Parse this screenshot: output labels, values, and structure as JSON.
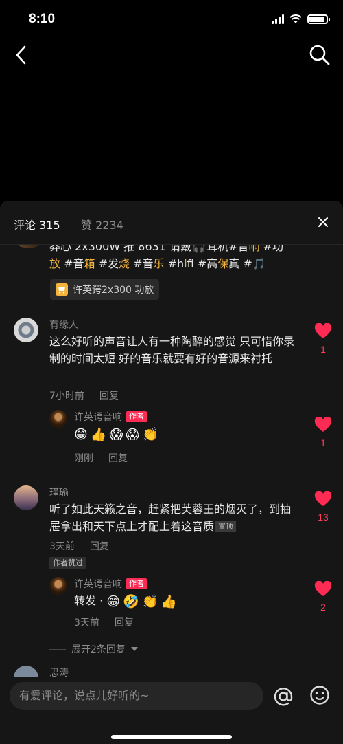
{
  "status_bar": {
    "time": "8:10",
    "battery_level": 0.9
  },
  "nav": {
    "back_icon": "chevron-left-icon",
    "search_icon": "search-icon"
  },
  "sheet": {
    "tab_comments": "评论 315",
    "tab_likes": "赞 2234",
    "close_icon": "close-icon"
  },
  "post": {
    "line1_pre": "莽心 2x300W 推 8631 请戴",
    "line1_mid": "耳机#音",
    "line1_hl": "响",
    "line1_post": " #功",
    "line2": [
      {
        "t": "放",
        "hl": true
      },
      {
        "t": " #音",
        "hl": false
      },
      {
        "t": "箱",
        "hl": true
      },
      {
        "t": " #发",
        "hl": false
      },
      {
        "t": "烧",
        "hl": true
      },
      {
        "t": " #音",
        "hl": false
      },
      {
        "t": "乐",
        "hl": true
      },
      {
        "t": " #h",
        "hl": false
      },
      {
        "t": "i",
        "hl": true
      },
      {
        "t": "fi #高",
        "hl": false
      },
      {
        "t": "保",
        "hl": true
      },
      {
        "t": "真",
        "hl": false
      },
      {
        "t": " #",
        "hl": false
      }
    ],
    "product_tag": "许英谔2x300 功放"
  },
  "comments": [
    {
      "username": "有缘人",
      "text": "这么好听的声音让人有一种陶醉的感觉 只可惜你录制的时间太短 好的音乐就要有好的音源来衬托",
      "time": "7小时前",
      "reply_label": "回复",
      "likes": "1"
    },
    {
      "username": "许英谔音响",
      "badge": "作者",
      "emojis": [
        "😁",
        "👍",
        "😱",
        "😱",
        "👏"
      ],
      "time": "刚刚",
      "reply_label": "回复",
      "likes": "1"
    },
    {
      "username": "瑾瑜",
      "text": "听了如此天籁之音，赶紧把芙蓉王的烟灭了，到抽屉拿出和天下点上才配上着这音质",
      "pin_badge": "置顶",
      "time": "3天前",
      "reply_label": "回复",
      "author_liked": "作者赞过",
      "likes": "13"
    },
    {
      "username": "许英谔音响",
      "badge": "作者",
      "text": "转发 · ",
      "emojis": [
        "😁",
        "🤣",
        "👏",
        "👍"
      ],
      "time": "3天前",
      "reply_label": "回复",
      "likes": "2"
    }
  ],
  "expand_replies": "展开2条回复",
  "next_username_partial": "思涛",
  "input": {
    "placeholder": "有爱评论，说点儿好听的~"
  },
  "colors": {
    "accent": "#f3b33c",
    "like": "#fe2c55",
    "sheet_bg": "#161616"
  }
}
